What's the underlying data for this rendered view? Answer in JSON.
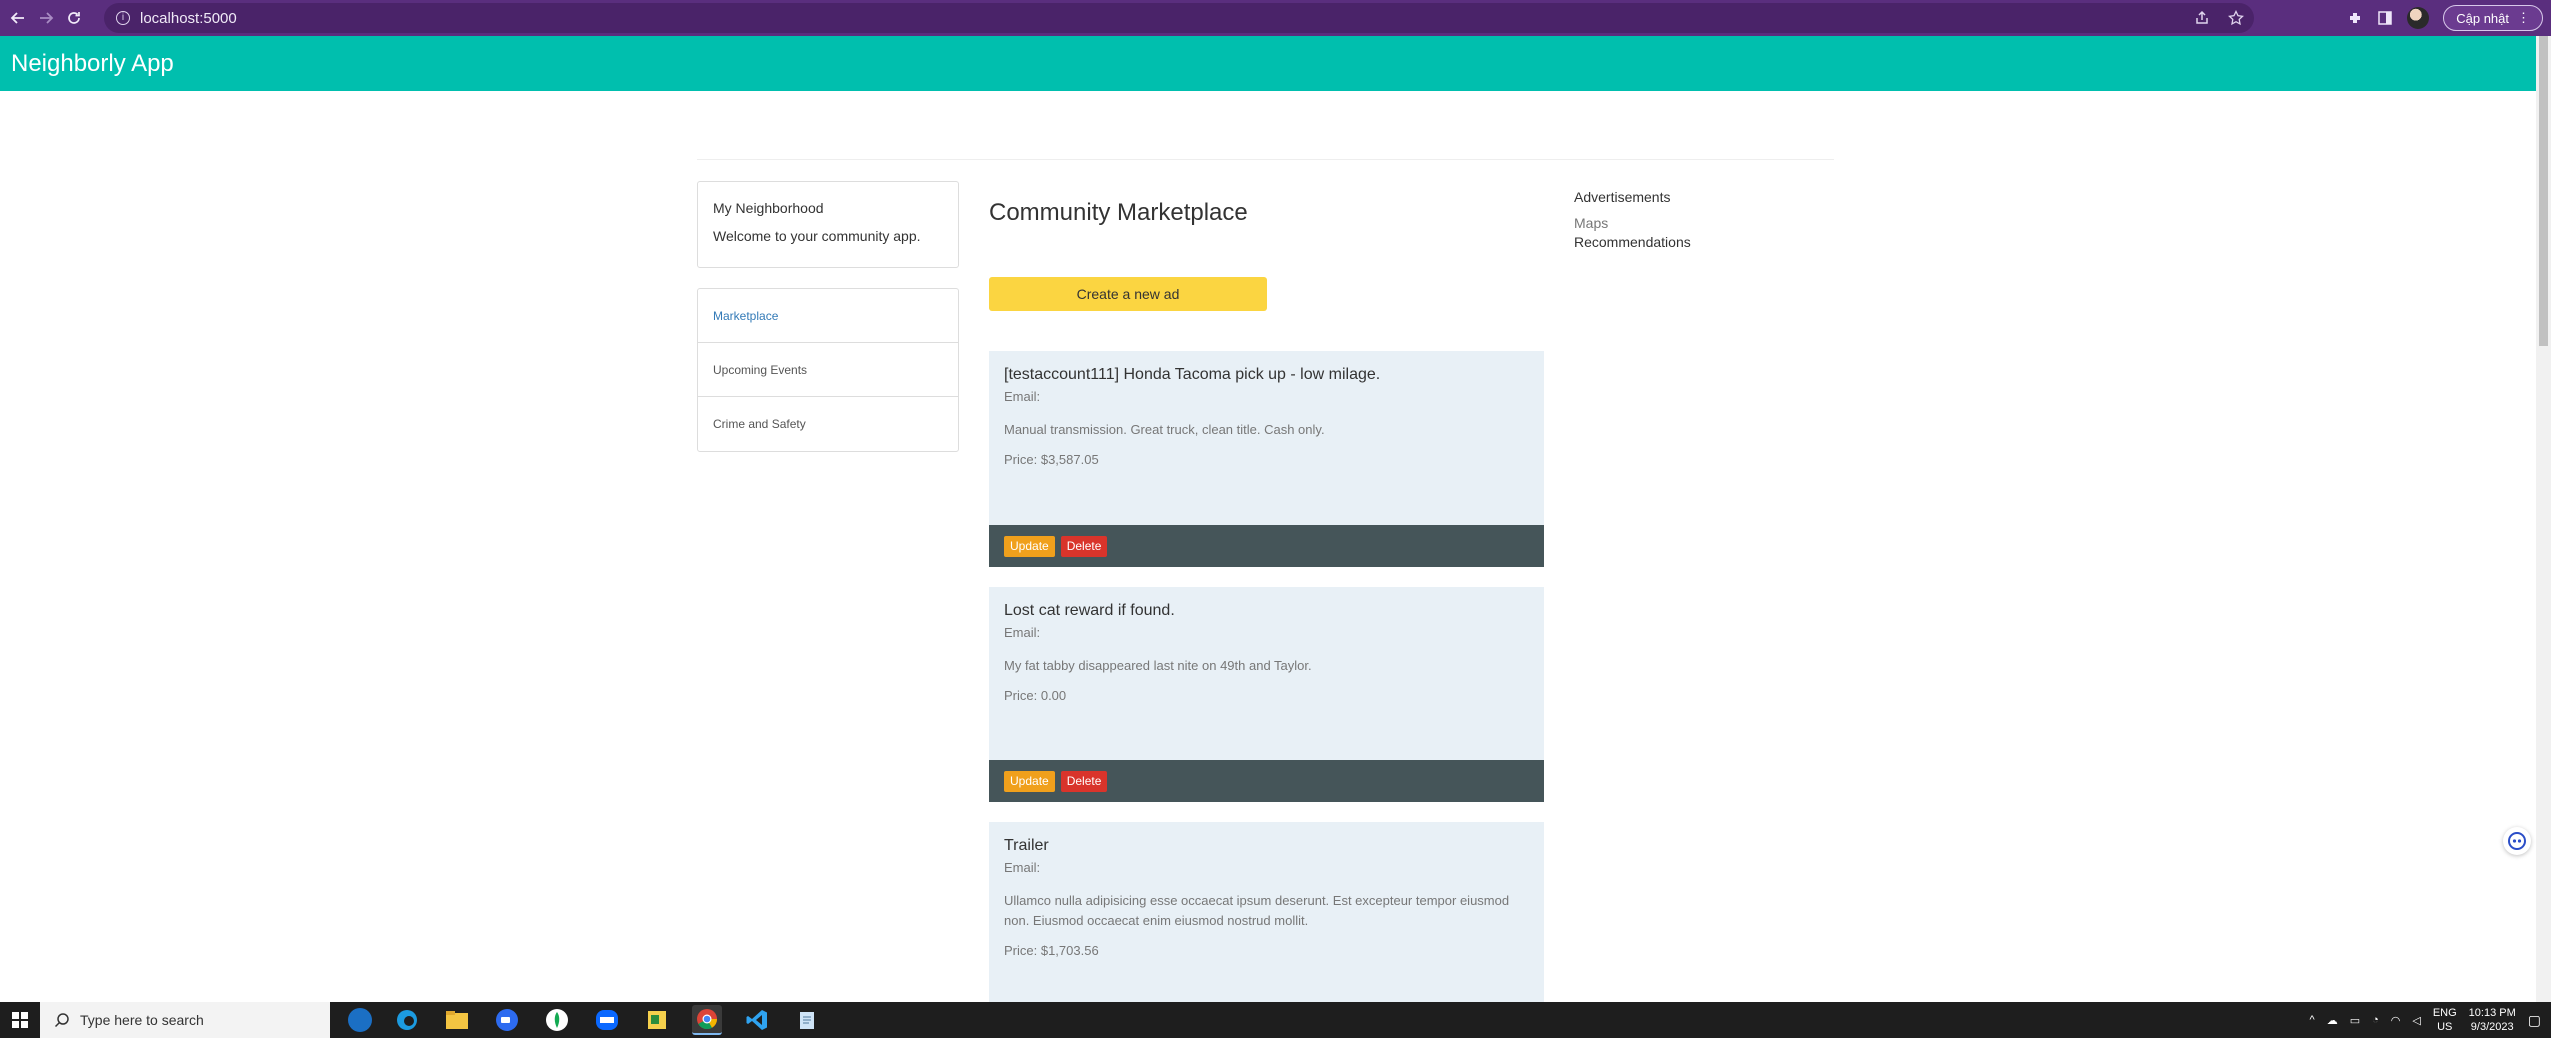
{
  "browser": {
    "url": "localhost:5000",
    "update_label": "Cập nhật"
  },
  "app": {
    "title": "Neighborly App"
  },
  "welcome": {
    "heading": "My Neighborhood",
    "text": "Welcome to your community app."
  },
  "nav": {
    "items": [
      {
        "label": "Marketplace"
      },
      {
        "label": "Upcoming Events"
      },
      {
        "label": "Crime and Safety"
      }
    ]
  },
  "main": {
    "heading": "Community Marketplace",
    "create_label": "Create a new ad",
    "ads": [
      {
        "title": "[testaccount111] Honda Tacoma pick up - low milage.",
        "email": "Email:",
        "description": "Manual transmission. Great truck, clean title. Cash only.",
        "price": "Price: $3,587.05",
        "update_label": "Update",
        "delete_label": "Delete"
      },
      {
        "title": "Lost cat reward if found.",
        "email": "Email:",
        "description": "My fat tabby disappeared last nite on 49th and Taylor.",
        "price": "Price: 0.00",
        "update_label": "Update",
        "delete_label": "Delete"
      },
      {
        "title": "Trailer",
        "email": "Email:",
        "description": "Ullamco nulla adipisicing esse occaecat ipsum deserunt. Est excepteur tempor eiusmod non. Eiusmod occaecat enim eiusmod nostrud mollit.",
        "price": "Price: $1,703.56"
      }
    ]
  },
  "sidebar_right": {
    "advertisements": "Advertisements",
    "maps": "Maps",
    "recommendations": "Recommendations"
  },
  "taskbar": {
    "search_placeholder": "Type here to search",
    "lang_line1": "ENG",
    "lang_line2": "US",
    "time": "10:13 PM",
    "date": "9/3/2023"
  },
  "colors": {
    "browser_bar": "#5a2e7e",
    "app_header": "#00bfae",
    "create_button": "#fbd541",
    "card_bg": "#e8f0f6",
    "card_footer": "#455559",
    "update_button": "#f0a01c",
    "delete_button": "#d9342b",
    "nav_active": "#337ab7"
  }
}
